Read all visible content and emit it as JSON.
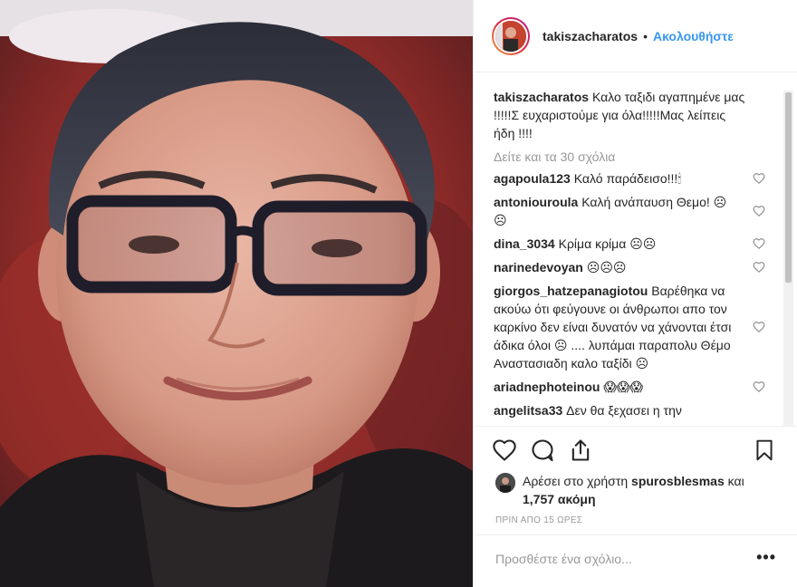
{
  "header": {
    "username": "takiszacharatos",
    "separator": "•",
    "follow": "Ακολουθήστε"
  },
  "caption": {
    "username": "takiszacharatos",
    "text": " Καλο ταξιδι αγαπημένε μας !!!!!Σ ευχαριστούμε για όλα!!!!!Μας λείπεις ήδη !!!!"
  },
  "view_all": "Δείτε και τα 30 σχόλια",
  "comments": [
    {
      "username": "agapoula123",
      "text": " Καλό παράδεισο!!!🕯"
    },
    {
      "username": "antoniouroula",
      "text": " Καλή ανάπαυση Θεμο! ☹☹"
    },
    {
      "username": "dina_3034",
      "text": " Κρίμα κρίμα ☹☹"
    },
    {
      "username": "narinedevoyan",
      "text": " ☹☹☹"
    },
    {
      "username": "giorgos_hatzepanagiotou",
      "text": " Βαρέθηκα να ακούω ότι φεύγουνε οι άνθρωποι απο τον καρκίνο δεν είναι δυνατόν να χάνονται έτσι άδικα όλοι ☹ .... λυπάμαι παραπολυ Θέμο Αναστασιαδη καλο ταξίδι ☹"
    },
    {
      "username": "ariadnephoteinou",
      "text": " 😱😱😱"
    },
    {
      "username": "angelitsa33",
      "text": " Δεν θα ξεχασει η την"
    }
  ],
  "likes": {
    "prefix": "Αρέσει στο χρήστη ",
    "user": "spurosblesmas",
    "middle": " και ",
    "count": "1,757 ακόμη"
  },
  "timestamp": "ΠΡΙΝ ΑΠΟ 15 ΩΡΕΣ",
  "add_comment": {
    "placeholder": "Προσθέστε ένα σχόλιο...",
    "more": "•••"
  },
  "icons": {
    "like": "heart-icon",
    "comment": "comment-bubble-icon",
    "share": "share-icon",
    "save": "bookmark-icon",
    "comment_like": "heart-icon"
  },
  "colors": {
    "link": "#3897f0",
    "text": "#262626",
    "muted": "#999999",
    "border": "#efefef"
  }
}
